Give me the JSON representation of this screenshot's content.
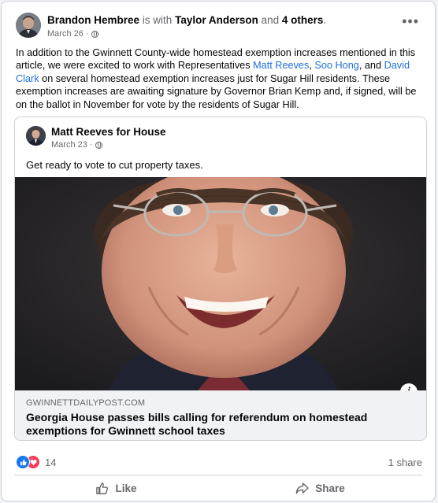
{
  "post": {
    "author": "Brandon Hembree",
    "is_with": "is with",
    "tagged": "Taylor Anderson",
    "and": "and",
    "others": "4 others",
    "period": ".",
    "date": "March 26",
    "dot": "·",
    "more_label": "•••",
    "body": {
      "p1": "In addition to the Gwinnett County-wide homestead exemption increases mentioned in this article, we were excited to work with Representatives",
      "link1": "Matt Reeves",
      "sep1": ",",
      "link2": "Soo Hong",
      "sep2": ", and",
      "link3": "David Clark",
      "p2": "on several homestead exemption increases just for Sugar Hill residents. These exemption increases are awaiting signature by Governor Brian Kemp and, if signed, will be on the ballot in November for vote by the residents of Sugar Hill."
    }
  },
  "shared": {
    "author": "Matt Reeves for House",
    "date": "March 23",
    "dot": "·",
    "text": "Get ready to vote to cut property taxes.",
    "info_label": "i",
    "link": {
      "domain": "GWINNETTDAILYPOST.COM",
      "headline": "Georgia House passes bills calling for referendum on homestead exemptions for Gwinnett school taxes"
    }
  },
  "footer": {
    "reaction_count": "14",
    "shares": "1 share",
    "like_label": "Like",
    "share_label": "Share"
  },
  "colors": {
    "link": "#216fdb",
    "like_reaction": "#1877f2",
    "love_reaction": "#f33e58",
    "muted_text": "#65676b"
  }
}
